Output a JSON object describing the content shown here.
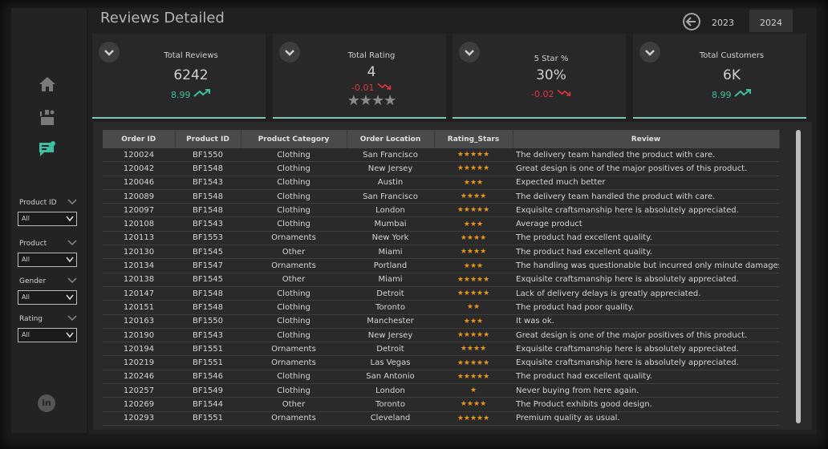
{
  "page": {
    "title": "Reviews Detailed"
  },
  "years": [
    "2023",
    "2024"
  ],
  "kpis": [
    {
      "title": "Total Reviews",
      "value": "6242",
      "delta": "8.99",
      "trend": "up"
    },
    {
      "title": "Total Rating",
      "value": "4",
      "delta": "-0.01",
      "trend": "down",
      "stars_filled": 4
    },
    {
      "title": "5 Star %",
      "value": "30%",
      "delta": "-0.02",
      "trend": "down"
    },
    {
      "title": "Total Customers",
      "value": "6K",
      "delta": "8.99",
      "trend": "up"
    }
  ],
  "filters": [
    {
      "label": "Product ID",
      "value": "All"
    },
    {
      "label": "Product",
      "value": "All"
    },
    {
      "label": "Gender",
      "value": "All"
    },
    {
      "label": "Rating",
      "value": "All"
    }
  ],
  "nav": {
    "items": [
      "home-icon",
      "team-icon",
      "reviews-icon"
    ],
    "footer": "linkedin-icon",
    "footer_text": "in"
  },
  "colors": {
    "accent": "#3fbfa0",
    "negative": "#e0353b",
    "star": "#e8951a"
  },
  "table": {
    "columns": [
      "Order ID",
      "Product ID",
      "Product Category",
      "Order Location",
      "Rating_Stars",
      "Review"
    ],
    "rows": [
      [
        "120024",
        "BF1550",
        "Clothing",
        "San Francisco",
        "★★★★★",
        "The delivery team handled the product with care."
      ],
      [
        "120042",
        "BF1548",
        "Clothing",
        "New Jersey",
        "★★★★★",
        "Great design is one of the major positives of this product."
      ],
      [
        "120046",
        "BF1543",
        "Clothing",
        "Austin",
        "★★★",
        "Expected much better"
      ],
      [
        "120089",
        "BF1548",
        "Clothing",
        "San Francisco",
        "★★★★",
        "The delivery team handled the product with care."
      ],
      [
        "120097",
        "BF1548",
        "Clothing",
        "London",
        "★★★★★",
        "Exquisite craftsmanship here is absolutely appreciated."
      ],
      [
        "120108",
        "BF1543",
        "Clothing",
        "Mumbai",
        "★★★",
        "Average product"
      ],
      [
        "120113",
        "BF1553",
        "Ornaments",
        "New York",
        "★★★★",
        "The product had excellent quality."
      ],
      [
        "120130",
        "BF1545",
        "Other",
        "Miami",
        "★★★★",
        "The product had excellent quality."
      ],
      [
        "120134",
        "BF1547",
        "Ornaments",
        "Portland",
        "★★★",
        "The handling was questionable but incurred only minute damages."
      ],
      [
        "120138",
        "BF1545",
        "Other",
        "Miami",
        "★★★★★",
        "Exquisite craftsmanship here is absolutely appreciated."
      ],
      [
        "120147",
        "BF1548",
        "Clothing",
        "Detroit",
        "★★★★★",
        "Lack of delivery delays is greatly appreciated."
      ],
      [
        "120151",
        "BF1548",
        "Clothing",
        "Toronto",
        "★★",
        "The product had poor quality."
      ],
      [
        "120163",
        "BF1550",
        "Clothing",
        "Manchester",
        "★★★",
        "It was ok."
      ],
      [
        "120190",
        "BF1543",
        "Clothing",
        "New Jersey",
        "★★★★★",
        "Great design is one of the major positives of this product."
      ],
      [
        "120194",
        "BF1551",
        "Ornaments",
        "Detroit",
        "★★★★",
        "Exquisite craftsmanship here is absolutely appreciated."
      ],
      [
        "120219",
        "BF1551",
        "Ornaments",
        "Las Vegas",
        "★★★★★",
        "Exquisite craftsmanship here is absolutely appreciated."
      ],
      [
        "120246",
        "BF1546",
        "Clothing",
        "San Antonio",
        "★★★★★",
        "The product had excellent quality."
      ],
      [
        "120257",
        "BF1549",
        "Clothing",
        "London",
        "★",
        "Never buying from here again."
      ],
      [
        "120269",
        "BF1544",
        "Other",
        "Toronto",
        "★★★★",
        "The Product exhibits good design."
      ],
      [
        "120293",
        "BF1551",
        "Ornaments",
        "Cleveland",
        "★★★★★",
        "Premium quality as usual."
      ]
    ]
  }
}
